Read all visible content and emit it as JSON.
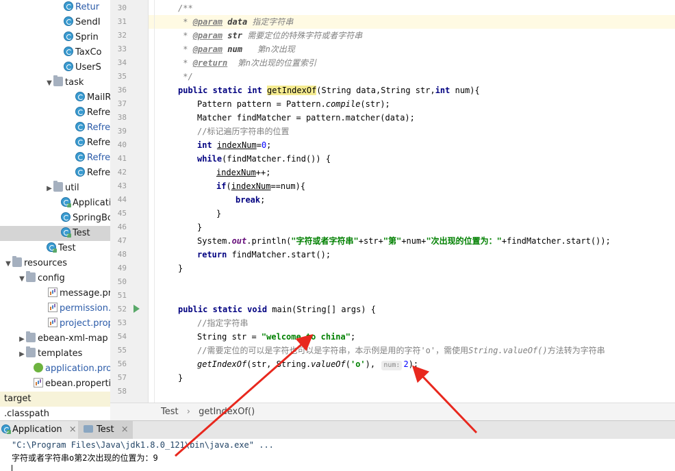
{
  "project_tree": {
    "items": [
      {
        "label": "Retur",
        "icon": "class-icon",
        "blue": true
      },
      {
        "label": "SendI",
        "icon": "class-icon"
      },
      {
        "label": "Sprin",
        "icon": "class-icon"
      },
      {
        "label": "TaxCo",
        "icon": "class-icon"
      },
      {
        "label": "UserS",
        "icon": "class-icon"
      },
      {
        "label": "task",
        "icon": "folder-icon"
      },
      {
        "label": "MailR",
        "icon": "class-icon"
      },
      {
        "label": "Refre",
        "icon": "class-icon"
      },
      {
        "label": "Refre",
        "icon": "class-icon",
        "blue": true
      },
      {
        "label": "Refre",
        "icon": "class-icon"
      },
      {
        "label": "Refre",
        "icon": "class-icon",
        "blue": true
      },
      {
        "label": "Refre",
        "icon": "class-icon"
      },
      {
        "label": "util",
        "icon": "folder-icon"
      },
      {
        "label": "Applicati",
        "icon": "class-icon"
      },
      {
        "label": "SpringBo",
        "icon": "class-icon"
      },
      {
        "label": "Test",
        "icon": "class-icon"
      },
      {
        "label": "Test",
        "icon": "class-icon"
      },
      {
        "label": "resources",
        "icon": "folder-icon"
      },
      {
        "label": "config",
        "icon": "folder-icon"
      },
      {
        "label": "message.pro",
        "icon": "properties-icon"
      },
      {
        "label": "permission.p",
        "icon": "properties-icon",
        "blue": true
      },
      {
        "label": "project.prop",
        "icon": "properties-icon",
        "blue": true
      },
      {
        "label": "ebean-xml-map",
        "icon": "folder-icon"
      },
      {
        "label": "templates",
        "icon": "folder-icon"
      },
      {
        "label": "application.prop",
        "icon": "spring-icon",
        "blue": true
      },
      {
        "label": "ebean.propertie",
        "icon": "properties-icon"
      },
      {
        "label": "target",
        "icon": "none"
      },
      {
        "label": ".classpath",
        "icon": "file-icon"
      }
    ]
  },
  "gutter": {
    "line_numbers": [
      "30",
      "31",
      "32",
      "33",
      "34",
      "35",
      "36",
      "37",
      "38",
      "39",
      "40",
      "41",
      "42",
      "43",
      "44",
      "45",
      "46",
      "47",
      "48",
      "49",
      "50",
      "51",
      "52",
      "53",
      "54",
      "55",
      "56",
      "57",
      "58"
    ]
  },
  "code": {
    "l30": "/**",
    "l31_star": " * ",
    "l31_tag": "@param",
    "l31_name": "data",
    "l31_desc": " 指定字符串",
    "l32_star": " * ",
    "l32_tag": "@param",
    "l32_name": "str",
    "l32_desc": " 需要定位的特殊字符或者字符串",
    "l33_star": " * ",
    "l33_tag": "@param",
    "l33_name": "num",
    "l33_desc": "   第n次出现",
    "l34_star": " * ",
    "l34_tag": "@return",
    "l34_desc": "  第n次出现的位置索引",
    "l35": " */",
    "l36_kw": "public static int ",
    "l36_method": "getIndexOf",
    "l36_a": "(String data,String str,",
    "l36_kw2": "int",
    "l36_b": " num){",
    "l37_a": "Pattern pattern = Pattern.",
    "l37_it": "compile",
    "l37_b": "(str);",
    "l38": "Matcher findMatcher = pattern.matcher(data);",
    "l39": "//标记遍历字符串的位置",
    "l40_kw": "int ",
    "l40_var": "indexNum",
    "l40_eq": "=",
    "l40_num": "0",
    "l40_end": ";",
    "l41_kw": "while",
    "l41_rest": "(findMatcher.find()) {",
    "l42_var": "indexNum",
    "l42_rest": "++;",
    "l43_kw": "if",
    "l43_a": "(",
    "l43_var": "indexNum",
    "l43_b": "==num){",
    "l44_kw": "break",
    "l44_end": ";",
    "l45": "}",
    "l46": "}",
    "l47_a": "System.",
    "l47_out": "out",
    "l47_b": ".println(",
    "l47_s1": "\"字符或者字符串\"",
    "l47_c": "+str+",
    "l47_s2": "\"第\"",
    "l47_d": "+num+",
    "l47_s3": "\"次出现的位置为：\"",
    "l47_e": "+findMatcher.start());",
    "l48_kw": "return",
    "l48_rest": " findMatcher.start();",
    "l49": "}",
    "l52_kw": "public static void ",
    "l52_rest": "main(String[] args) {",
    "l53": "//指定字符串",
    "l54_a": "String str = ",
    "l54_str": "\"welcome to china\"",
    "l54_end": ";",
    "l55_a": "//需要定位的可以是字符也可以是字符串，本示例是用的字符'o'，需使用",
    "l55_it": "String.valueOf()",
    "l55_b": "方法转为字符串",
    "l56_a": "getIndexOf",
    "l56_b": "(str, String.",
    "l56_it": "valueOf",
    "l56_c": "(",
    "l56_str": "'o'",
    "l56_d": "), ",
    "l56_hint": "num:",
    "l56_num": "2",
    "l56_end": ");",
    "l57": "}"
  },
  "breadcrumb": {
    "class": "Test",
    "sep": "›",
    "method": "getIndexOf()"
  },
  "run_tabs": [
    {
      "label": "Application",
      "close": "×"
    },
    {
      "label": "Test",
      "close": "×"
    }
  ],
  "console": {
    "cmd": "\"C:\\Program Files\\Java\\jdk1.8.0_121\\bin\\java.exe\" ...",
    "output": "字符或者字符串o第2次出现的位置为：9"
  },
  "colors": {
    "annotation_arrow": "#e8281e",
    "keyword": "#000080",
    "string": "#008000"
  }
}
